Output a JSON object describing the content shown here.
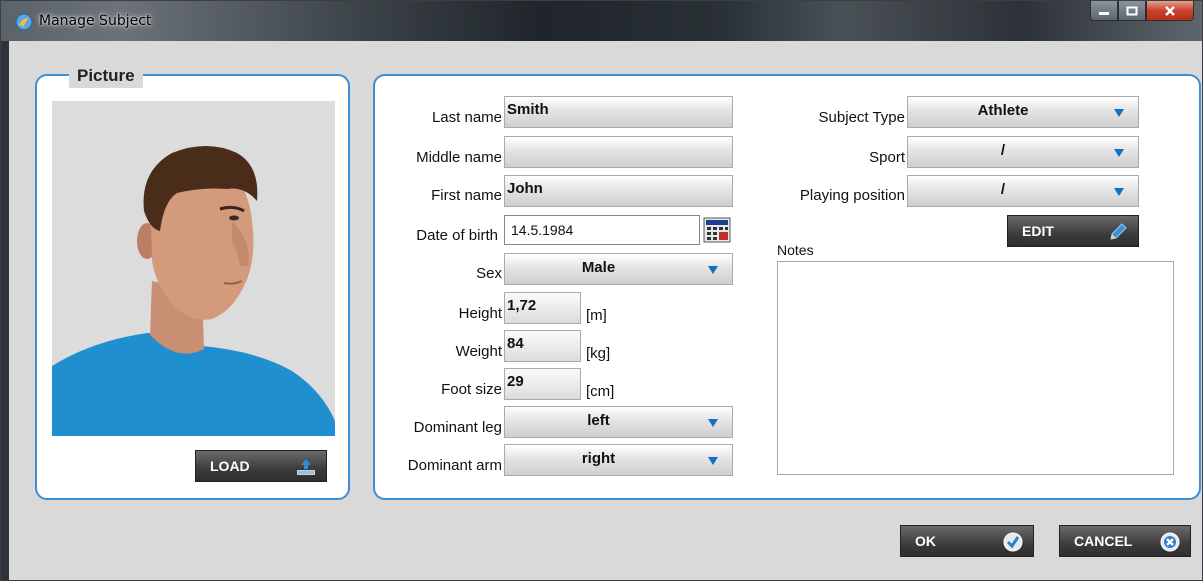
{
  "window": {
    "title": "Manage Subject"
  },
  "picture": {
    "legend": "Picture",
    "load_label": "LOAD"
  },
  "form": {
    "last_name": {
      "label": "Last name",
      "value": "Smith"
    },
    "middle_name": {
      "label": "Middle name",
      "value": ""
    },
    "first_name": {
      "label": "First name",
      "value": "John"
    },
    "date_of_birth": {
      "label": "Date of birth",
      "value": "14.5.1984"
    },
    "sex": {
      "label": "Sex",
      "value": "Male"
    },
    "height": {
      "label": "Height",
      "value": "1,72",
      "unit": "[m]"
    },
    "weight": {
      "label": "Weight",
      "value": "84",
      "unit": "[kg]"
    },
    "foot_size": {
      "label": "Foot size",
      "value": "29",
      "unit": "[cm]"
    },
    "dominant_leg": {
      "label": "Dominant leg",
      "value": "left"
    },
    "dominant_arm": {
      "label": "Dominant arm",
      "value": "right"
    },
    "subject_type": {
      "label": "Subject Type",
      "value": "Athlete"
    },
    "sport": {
      "label": "Sport",
      "value": "/"
    },
    "playing_position": {
      "label": "Playing position",
      "value": "/"
    },
    "edit_label": "EDIT",
    "notes_label": "Notes"
  },
  "footer": {
    "ok_label": "OK",
    "cancel_label": "CANCEL"
  },
  "colors": {
    "accent": "#3d8ed2",
    "arrow": "#1470c6"
  }
}
